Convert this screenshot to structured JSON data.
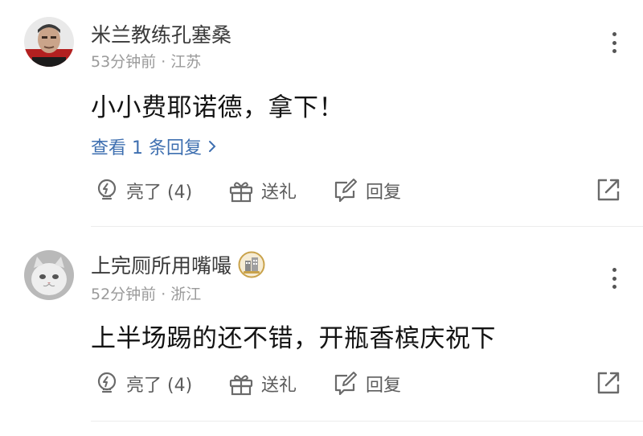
{
  "comments": [
    {
      "username": "米兰教练孔塞桑",
      "time": "53分钟前",
      "separator": "·",
      "location": "江苏",
      "content": "小小费耶诺德，拿下！",
      "replies_link": "查看 1 条回复",
      "actions": {
        "like": "亮了 (4)",
        "gift": "送礼",
        "reply": "回复"
      },
      "avatar_icon": "man-portrait-avatar",
      "badge": null
    },
    {
      "username": "上完厕所用嘴嘬",
      "time": "52分钟前",
      "separator": "·",
      "location": "浙江",
      "content": "上半场踢的还不错，开瓶香槟庆祝下",
      "replies_link": null,
      "actions": {
        "like": "亮了 (4)",
        "gift": "送礼",
        "reply": "回复"
      },
      "avatar_icon": "white-cat-avatar",
      "badge": "building-level-badge-icon"
    }
  ],
  "colors": {
    "link": "#3e6fb0",
    "text": "#141414",
    "meta": "#9a9a9a",
    "action": "#5c5c5c",
    "badge_gold": "#c9a24a"
  }
}
